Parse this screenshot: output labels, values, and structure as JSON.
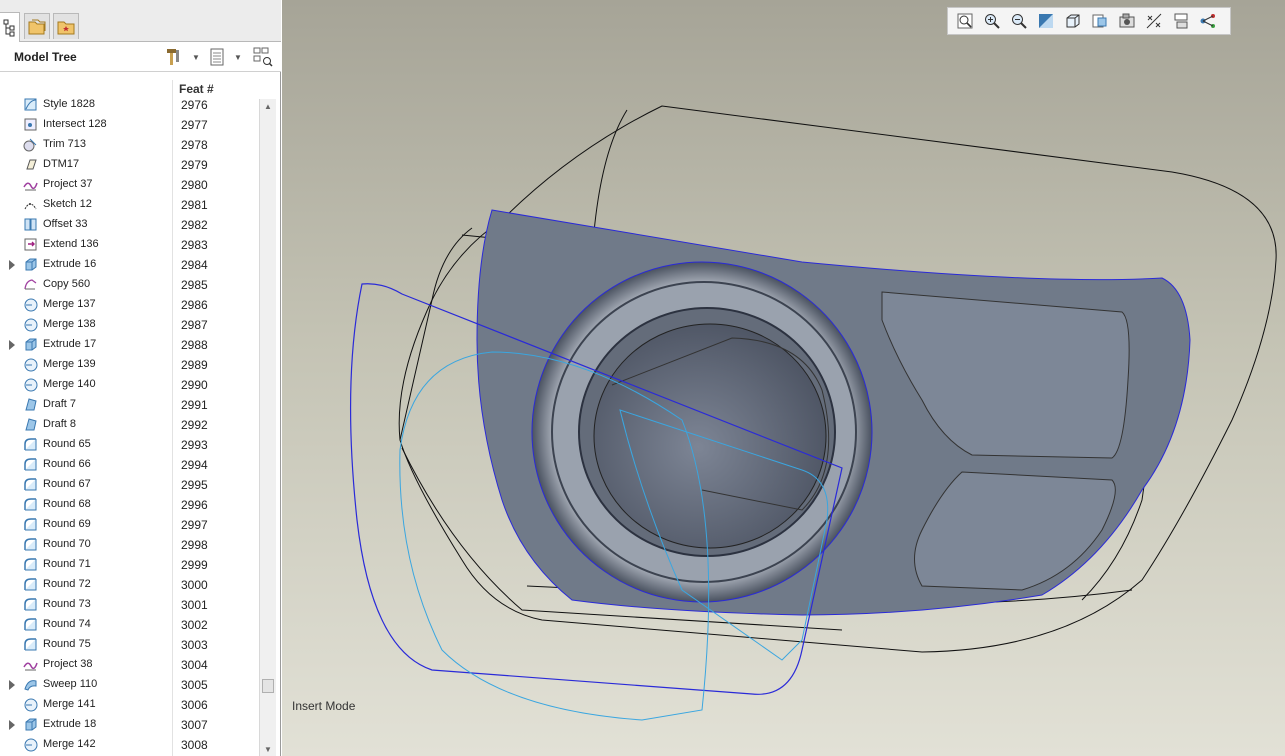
{
  "left_panel": {
    "title": "Model Tree",
    "feat_column": "Feat #",
    "features": [
      {
        "name": "Style 1828",
        "num": "2976",
        "icon": "style-icon",
        "expandable": false
      },
      {
        "name": "Intersect 128",
        "num": "2977",
        "icon": "intersect-icon",
        "expandable": false
      },
      {
        "name": "Trim 713",
        "num": "2978",
        "icon": "trim-icon",
        "expandable": false
      },
      {
        "name": "DTM17",
        "num": "2979",
        "icon": "datum-plane-icon",
        "expandable": false
      },
      {
        "name": "Project 37",
        "num": "2980",
        "icon": "project-icon",
        "expandable": false
      },
      {
        "name": "Sketch 12",
        "num": "2981",
        "icon": "sketch-icon",
        "expandable": false
      },
      {
        "name": "Offset 33",
        "num": "2982",
        "icon": "offset-icon",
        "expandable": false
      },
      {
        "name": "Extend 136",
        "num": "2983",
        "icon": "extend-icon",
        "expandable": false
      },
      {
        "name": "Extrude 16",
        "num": "2984",
        "icon": "extrude-icon",
        "expandable": true
      },
      {
        "name": "Copy 560",
        "num": "2985",
        "icon": "copy-icon",
        "expandable": false
      },
      {
        "name": "Merge 137",
        "num": "2986",
        "icon": "merge-icon",
        "expandable": false
      },
      {
        "name": "Merge 138",
        "num": "2987",
        "icon": "merge-icon",
        "expandable": false
      },
      {
        "name": "Extrude 17",
        "num": "2988",
        "icon": "extrude-icon",
        "expandable": true
      },
      {
        "name": "Merge 139",
        "num": "2989",
        "icon": "merge-icon",
        "expandable": false
      },
      {
        "name": "Merge 140",
        "num": "2990",
        "icon": "merge-icon",
        "expandable": false
      },
      {
        "name": "Draft 7",
        "num": "2991",
        "icon": "draft-icon",
        "expandable": false
      },
      {
        "name": "Draft 8",
        "num": "2992",
        "icon": "draft-icon",
        "expandable": false
      },
      {
        "name": "Round 65",
        "num": "2993",
        "icon": "round-icon",
        "expandable": false
      },
      {
        "name": "Round 66",
        "num": "2994",
        "icon": "round-icon",
        "expandable": false
      },
      {
        "name": "Round 67",
        "num": "2995",
        "icon": "round-icon",
        "expandable": false
      },
      {
        "name": "Round 68",
        "num": "2996",
        "icon": "round-icon",
        "expandable": false
      },
      {
        "name": "Round 69",
        "num": "2997",
        "icon": "round-icon",
        "expandable": false
      },
      {
        "name": "Round 70",
        "num": "2998",
        "icon": "round-icon",
        "expandable": false
      },
      {
        "name": "Round 71",
        "num": "2999",
        "icon": "round-icon",
        "expandable": false
      },
      {
        "name": "Round 72",
        "num": "3000",
        "icon": "round-icon",
        "expandable": false
      },
      {
        "name": "Round 73",
        "num": "3001",
        "icon": "round-icon",
        "expandable": false
      },
      {
        "name": "Round 74",
        "num": "3002",
        "icon": "round-icon",
        "expandable": false
      },
      {
        "name": "Round 75",
        "num": "3003",
        "icon": "round-icon",
        "expandable": false
      },
      {
        "name": "Project 38",
        "num": "3004",
        "icon": "project-icon",
        "expandable": false
      },
      {
        "name": "Sweep 110",
        "num": "3005",
        "icon": "sweep-icon",
        "expandable": true
      },
      {
        "name": "Merge 141",
        "num": "3006",
        "icon": "merge-icon",
        "expandable": false
      },
      {
        "name": "Extrude 18",
        "num": "3007",
        "icon": "extrude-icon",
        "expandable": true
      },
      {
        "name": "Merge 142",
        "num": "3008",
        "icon": "merge-icon",
        "expandable": false
      }
    ]
  },
  "graphics": {
    "status": "Insert Mode",
    "toolbar": [
      {
        "icon": "refit-icon"
      },
      {
        "icon": "zoom-in-icon"
      },
      {
        "icon": "zoom-out-icon"
      },
      {
        "icon": "repaint-icon"
      },
      {
        "icon": "display-style-icon"
      },
      {
        "icon": "saved-views-icon"
      },
      {
        "icon": "view-manager-icon"
      },
      {
        "icon": "datum-display-icon"
      },
      {
        "icon": "annotation-display-icon"
      },
      {
        "icon": "spin-center-icon"
      }
    ]
  },
  "colors": {
    "surface": "#707a89",
    "highlight_blue": "#2a2ad8",
    "cyan_curve": "#3aa6e0",
    "edge_black": "#111111"
  }
}
